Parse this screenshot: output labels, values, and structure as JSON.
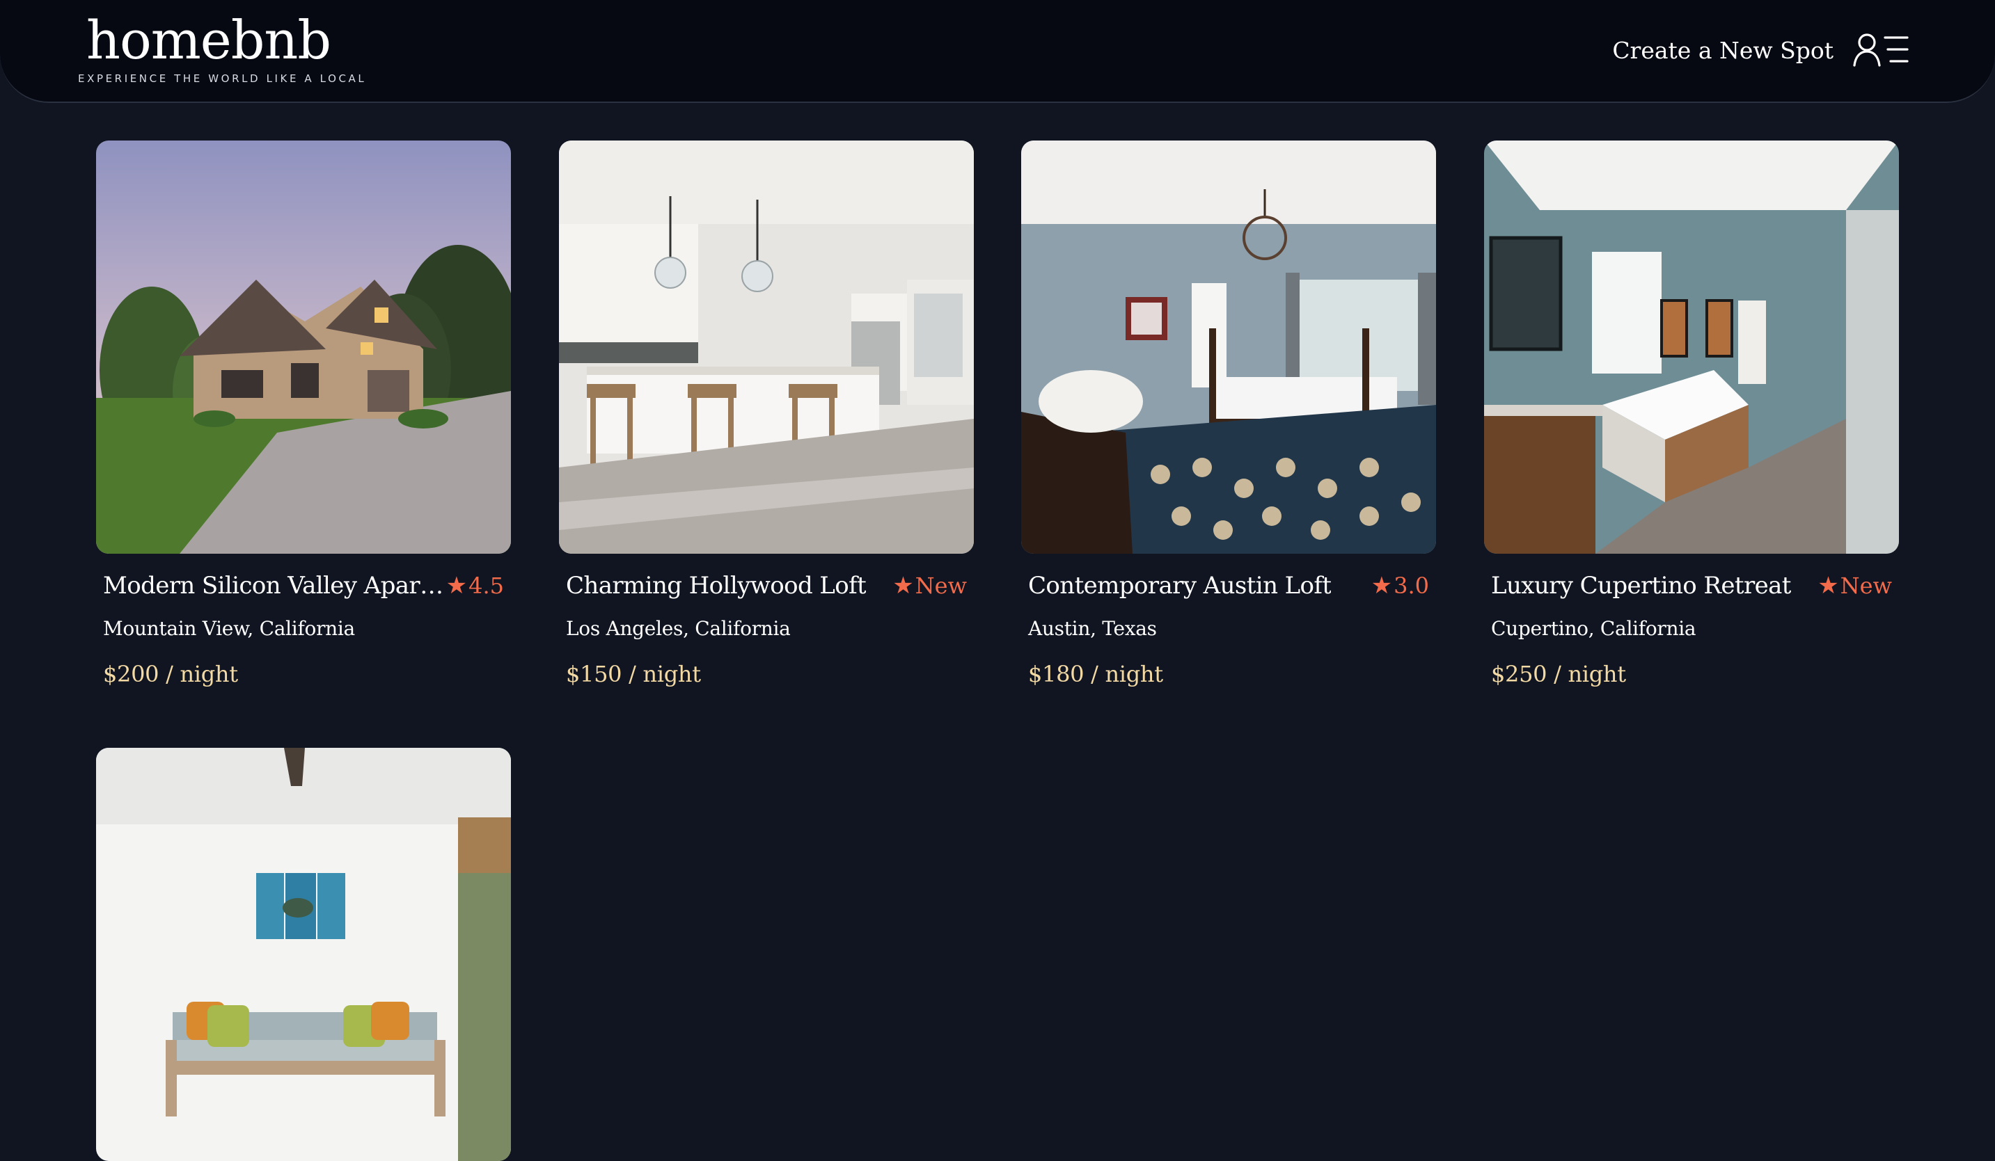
{
  "app": {
    "logo_name": "homebnb",
    "logo_tagline": "EXPERIENCE THE WORLD LIKE A LOCAL"
  },
  "nav": {
    "create_spot_label": "Create a New Spot",
    "user_menu_icon": "user-menu-icon"
  },
  "colors": {
    "background": "#101521",
    "header": "#060912",
    "accent_rating": "#f26b4a",
    "price": "#f3d9a4"
  },
  "spots": [
    {
      "title": "Modern Silicon Valley Apartm...",
      "rating": "4.5",
      "location": "Mountain View, California",
      "price": "$200 / night",
      "image": "brick house exterior with lawn and driveway"
    },
    {
      "title": "Charming Hollywood Loft",
      "rating": "New",
      "location": "Los Angeles, California",
      "price": "$150 / night",
      "image": "white kitchen with island and bar stools"
    },
    {
      "title": "Contemporary Austin Loft",
      "rating": "3.0",
      "location": "Austin, Texas",
      "price": "$180 / night",
      "image": "blue-gray bedroom with four-poster bed"
    },
    {
      "title": "Luxury Cupertino Retreat",
      "rating": "New",
      "location": "Cupertino, California",
      "price": "$250 / night",
      "image": "bathroom with soaking tub and wood vanity"
    },
    {
      "title": "",
      "rating": "",
      "location": "",
      "price": "",
      "image": "sunroom with daybed and turtle artwork"
    }
  ]
}
